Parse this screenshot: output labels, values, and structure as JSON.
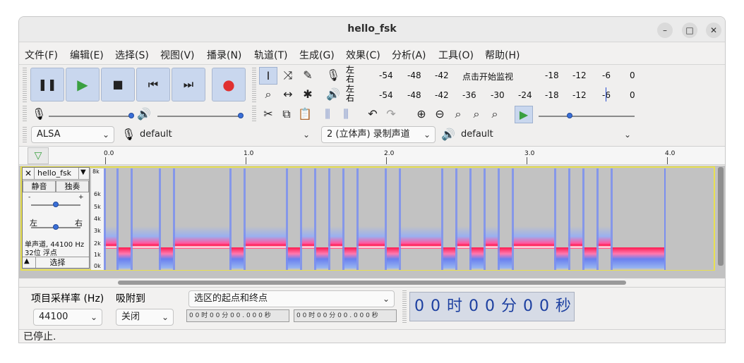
{
  "window": {
    "title": "hello_fsk",
    "minimize": "–",
    "maximize": "□",
    "close": "✕"
  },
  "menu": [
    "文件(F)",
    "编辑(E)",
    "选择(S)",
    "视图(V)",
    "播录(N)",
    "轨道(T)",
    "生成(G)",
    "效果(C)",
    "分析(A)",
    "工具(O)",
    "帮助(H)"
  ],
  "transport": {
    "pause": "pause-icon",
    "play": "play-icon",
    "stop": "stop-icon",
    "skip_start": "skip-start-icon",
    "skip_end": "skip-end-icon",
    "record": "record-icon"
  },
  "meters": {
    "rec_channel_top": "左",
    "rec_channel_bottom": "右",
    "play_channel_top": "左",
    "play_channel_bottom": "右",
    "rec_scale": [
      "-54",
      "-48",
      "-42",
      "点击开始监视",
      "-18",
      "-12",
      "-6",
      "0"
    ],
    "play_scale": [
      "-54",
      "-48",
      "-42",
      "-36",
      "-30",
      "-24",
      "-18",
      "-12",
      "-6",
      "0"
    ]
  },
  "device": {
    "host": "ALSA",
    "recording_device": "default",
    "channels": "2 (立体声) 录制声道",
    "playback_device": "default"
  },
  "timeline": {
    "ticks": [
      "0.0",
      "1.0",
      "2.0",
      "3.0",
      "4.0"
    ]
  },
  "track": {
    "name": "hello_fsk",
    "mute": "静音",
    "solo": "独奏",
    "pan_left": "左",
    "pan_right": "右",
    "info_line1": "单声道, 44100 Hz",
    "info_line2": "32位 浮点",
    "select": "选择",
    "freq_axis": [
      "8k",
      "6k",
      "5k",
      "4k",
      "3k",
      "2k",
      "1k",
      "0k"
    ]
  },
  "bottom": {
    "rate_label": "项目采样率 (Hz)",
    "rate_value": "44100",
    "snap_label": "吸附到",
    "snap_value": "关闭",
    "selection_mode": "选区的起点和终点",
    "sel_start": "0 0 时 0 0 分 0 0 . 0 0 0 秒",
    "sel_end": "0 0 时 0 0 分 0 0 . 0 0 0 秒",
    "time_display": "0 0 时 0 0 分 0 0 秒"
  },
  "status": "已停止.",
  "colors": {
    "accent": "#c9d7ee",
    "record": "#e03030",
    "play": "#3aa040",
    "spectrum_high": "#ff2060",
    "spectrum_low": "#5a78f0"
  }
}
